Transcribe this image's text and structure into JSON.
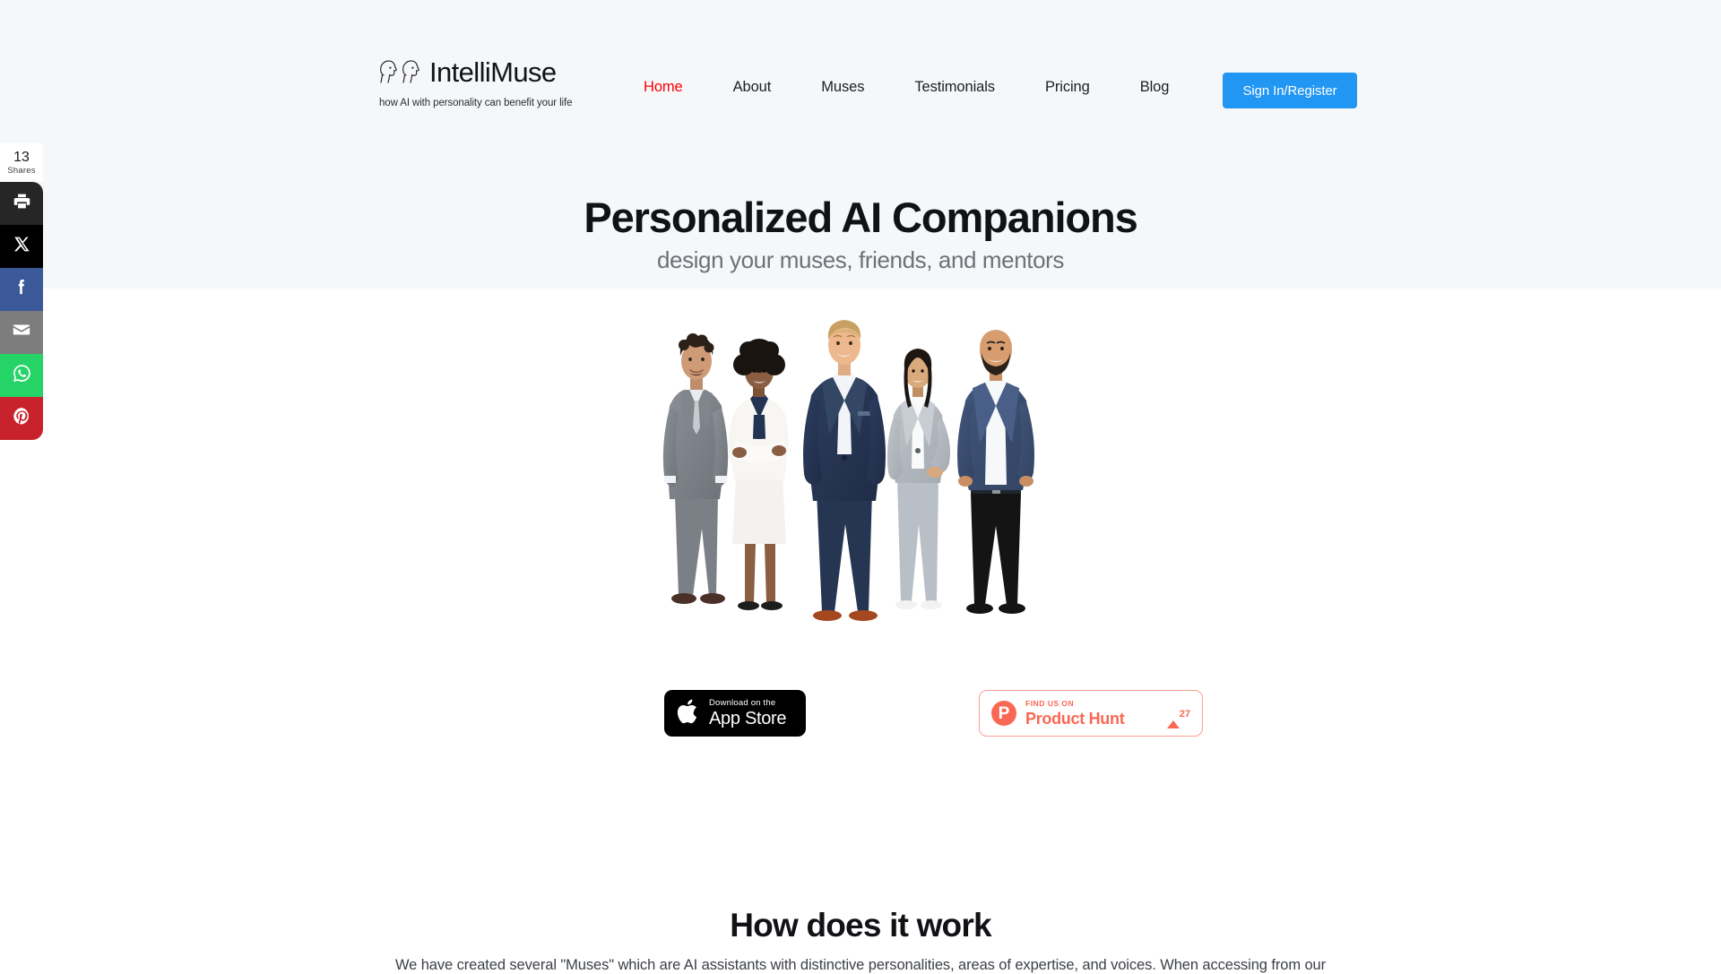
{
  "brand": {
    "name": "IntelliMuse",
    "tagline": "how AI with personality can benefit your life",
    "logo_icon": "two-head-profiles-icon"
  },
  "nav": {
    "items": [
      {
        "label": "Home",
        "active": true
      },
      {
        "label": "About",
        "active": false
      },
      {
        "label": "Muses",
        "active": false
      },
      {
        "label": "Testimonials",
        "active": false
      },
      {
        "label": "Pricing",
        "active": false
      },
      {
        "label": "Blog",
        "active": false
      }
    ],
    "active_color": "#fb0007",
    "link_color": "#1d1f24"
  },
  "signin": {
    "label": "Sign In/Register",
    "background": "#2196f3",
    "text_color": "#ffffff"
  },
  "share_sidebar": {
    "count": "13",
    "count_label": "Shares",
    "buttons": [
      {
        "name": "print",
        "icon": "printer-icon",
        "color": "#262626"
      },
      {
        "name": "x",
        "icon": "x-twitter-icon",
        "color": "#000000"
      },
      {
        "name": "facebook",
        "icon": "facebook-icon",
        "color": "#3b5998"
      },
      {
        "name": "email",
        "icon": "envelope-icon",
        "color": "#7d7d7d"
      },
      {
        "name": "whatsapp",
        "icon": "whatsapp-icon",
        "color": "#25d366"
      },
      {
        "name": "pinterest",
        "icon": "pinterest-icon",
        "color": "#c8232c"
      }
    ]
  },
  "hero": {
    "title": "Personalized AI Companions",
    "subtitle": "design your muses, friends, and mentors",
    "image_alt": "five business professionals standing together",
    "background": "#f6f7f9"
  },
  "badges": {
    "appstore": {
      "line1": "Download on the",
      "line2": "App Store",
      "icon": "apple-logo-icon",
      "background": "#000000"
    },
    "producthunt": {
      "line1": "FIND US ON",
      "line2": "Product Hunt",
      "upvote_count": "27",
      "icon": "producthunt-p-icon",
      "color": "#f96854",
      "border_color": "#f9a094"
    }
  },
  "how_section": {
    "title": "How does it work",
    "body": "We have created several \"Muses\" which are AI assistants with distinctive personalities, areas of expertise, and voices. When accessing from our"
  }
}
